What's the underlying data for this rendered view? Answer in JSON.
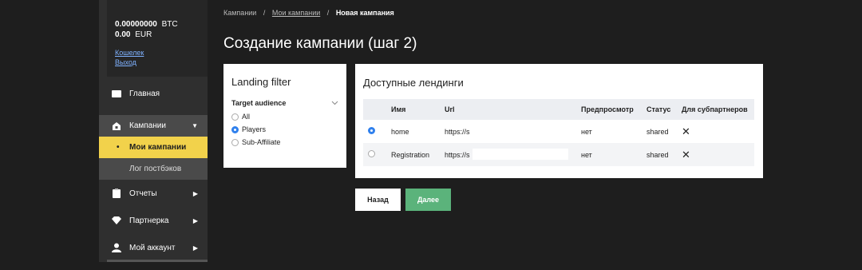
{
  "wallet": {
    "btc_amount": "0.00000000",
    "btc_currency": "BTC",
    "eur_amount": "0.00",
    "eur_currency": "EUR",
    "wallet_link": "Кошелек",
    "logout_link": "Выход"
  },
  "sidebar": {
    "home": "Главная",
    "campaigns": "Кампании",
    "my_campaigns": "Мои кампании",
    "postback_log": "Лог постбэков",
    "reports": "Отчеты",
    "partner": "Партнерка",
    "account": "Мой аккаунт"
  },
  "breadcrumb": {
    "root": "Кампании",
    "parent": "Мои кампании",
    "current": "Новая кампания"
  },
  "page_title": "Создание кампании (шаг 2)",
  "filter": {
    "title": "Landing filter",
    "audience_label": "Target audience",
    "options": [
      "All",
      "Players",
      "Sub-Affiliate"
    ],
    "selected": "Players"
  },
  "landings": {
    "title": "Доступные лендинги",
    "columns": [
      "Имя",
      "Url",
      "Предпросмотр",
      "Статус",
      "Для субпартнеров"
    ],
    "rows": [
      {
        "selected": true,
        "name": "home",
        "url": "https://s",
        "preview": "нет",
        "status": "shared",
        "sub": "✕"
      },
      {
        "selected": false,
        "name": "Registration",
        "url": "https://s",
        "preview": "нет",
        "status": "shared",
        "sub": "✕"
      }
    ]
  },
  "buttons": {
    "back": "Назад",
    "next": "Далее"
  },
  "colors": {
    "accent_yellow": "#f2d24b",
    "next_green": "#5bb37b",
    "radio_blue": "#2f80ed",
    "background": "#1e1e1e"
  }
}
